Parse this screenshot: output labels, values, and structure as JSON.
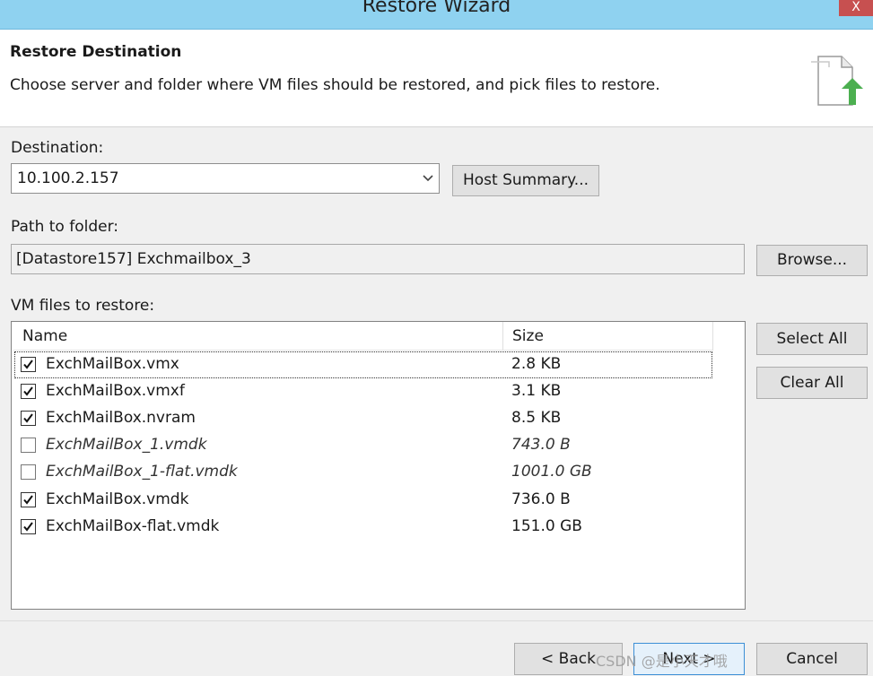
{
  "window": {
    "title": "Restore Wizard",
    "close_label": "X"
  },
  "header": {
    "title": "Restore Destination",
    "subtitle": "Choose server and folder where VM files should be restored, and pick files to restore.",
    "icon": "restore-files-icon"
  },
  "destination": {
    "label": "Destination:",
    "value": "10.100.2.157",
    "host_summary_button": "Host Summary..."
  },
  "path": {
    "label": "Path to folder:",
    "value": "[Datastore157] Exchmailbox_3",
    "browse_button": "Browse..."
  },
  "files": {
    "label": "VM files to restore:",
    "columns": {
      "name": "Name",
      "size": "Size"
    },
    "rows": [
      {
        "name": "ExchMailBox.vmx",
        "size": "2.8 KB",
        "checked": true
      },
      {
        "name": "ExchMailBox.vmxf",
        "size": "3.1 KB",
        "checked": true
      },
      {
        "name": "ExchMailBox.nvram",
        "size": "8.5 KB",
        "checked": true
      },
      {
        "name": "ExchMailBox_1.vmdk",
        "size": "743.0 B",
        "checked": false
      },
      {
        "name": "ExchMailBox_1-flat.vmdk",
        "size": "1001.0 GB",
        "checked": false
      },
      {
        "name": "ExchMailBox.vmdk",
        "size": "736.0 B",
        "checked": true
      },
      {
        "name": "ExchMailBox-flat.vmdk",
        "size": "151.0 GB",
        "checked": true
      }
    ],
    "select_all_button": "Select All",
    "clear_all_button": "Clear All"
  },
  "footer": {
    "back_button": "< Back",
    "next_button": "Next >",
    "cancel_button": "Cancel"
  },
  "watermark": "CSDN @是小天才哦"
}
